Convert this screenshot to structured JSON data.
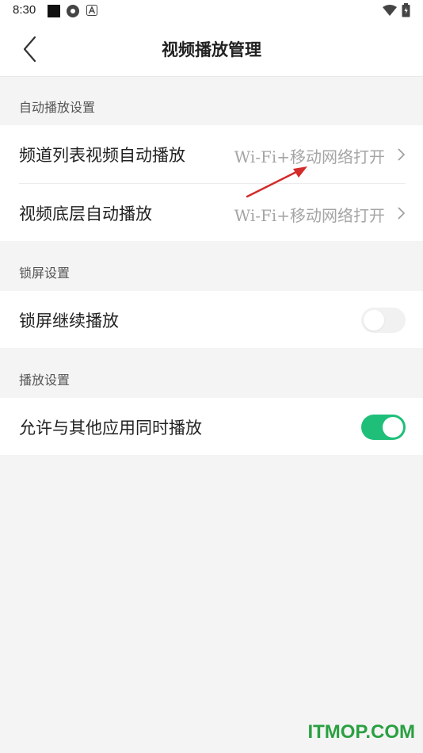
{
  "status_bar": {
    "time": "8:30",
    "icons": [
      "square-app-icon",
      "settings-app-icon",
      "a-app-icon",
      "wifi-icon",
      "battery-icon"
    ]
  },
  "header": {
    "title": "视频播放管理",
    "back_icon": "chevron-left-icon"
  },
  "sections": [
    {
      "label": "自动播放设置",
      "rows": [
        {
          "label": "频道列表视频自动播放",
          "value": "Wi-Fi+移动网络打开"
        },
        {
          "label": "视频底层自动播放",
          "value": "Wi-Fi+移动网络打开"
        }
      ]
    },
    {
      "label": "锁屏设置",
      "rows": [
        {
          "label": "锁屏继续播放",
          "toggle": false
        }
      ]
    },
    {
      "label": "播放设置",
      "rows": [
        {
          "label": "允许与其他应用同时播放",
          "toggle": true
        }
      ]
    }
  ],
  "colors": {
    "accent": "#1fbf79",
    "background": "#f4f4f4",
    "value_text": "#a5a5a5",
    "annotation_arrow": "#d42b2b",
    "watermark": "#2aa042"
  },
  "watermark": "ITMOP.COM"
}
